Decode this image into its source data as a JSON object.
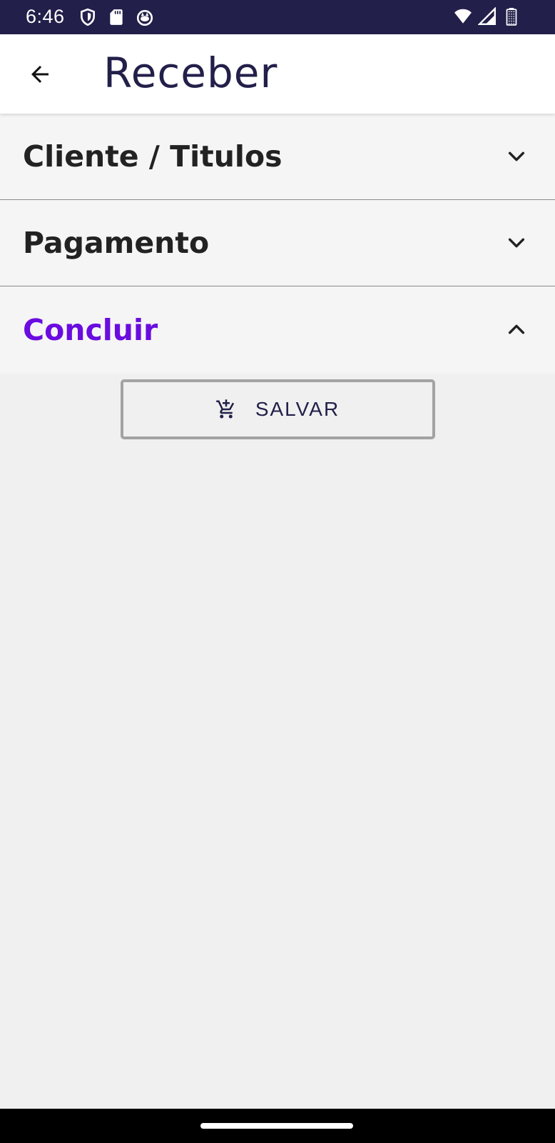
{
  "status_bar": {
    "time": "6:46",
    "left_icons": [
      "vpn-shield-icon",
      "sd-card-icon",
      "cat-face-icon"
    ],
    "right_icons": [
      "wifi-icon",
      "signal-icon",
      "battery-icon"
    ]
  },
  "app_bar": {
    "title": "Receber",
    "back_icon": "arrow-left-icon"
  },
  "accordion": {
    "sections": [
      {
        "label": "Cliente / Titulos",
        "expanded": false
      },
      {
        "label": "Pagamento",
        "expanded": false
      },
      {
        "label": "Concluir",
        "expanded": true
      }
    ]
  },
  "actions": {
    "save_label": "SALVAR",
    "save_icon": "cart-icon"
  },
  "colors": {
    "status_bar_bg": "#221f4a",
    "title_color": "#221f4a",
    "active_section": "#6a0ce0",
    "section_bg": "#f5f5f5",
    "page_bg": "#f0f0f0"
  }
}
